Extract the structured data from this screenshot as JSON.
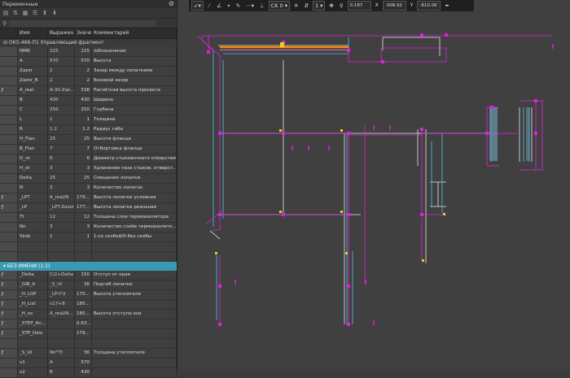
{
  "panel": {
    "title": "Переменные",
    "search_placeholder": "",
    "headers": [
      "",
      "Имя",
      "Выражен...",
      "Значе...",
      "Комментарий"
    ],
    "group1": "⊟  ОК5-466-П1 Управляющий фрагмент",
    "group2": "▾  БЕЗ ИМЕНИ (1:1)",
    "rows1": [
      {
        "icon": "",
        "name": "NMR",
        "expr": "225",
        "val": "225",
        "comment": "/обозначение"
      },
      {
        "icon": "",
        "name": "A",
        "expr": "570",
        "val": "570",
        "comment": "Высота"
      },
      {
        "icon": "",
        "name": "Zazor",
        "expr": "2",
        "val": "2",
        "comment": "Зазор между лопатками"
      },
      {
        "icon": "",
        "name": "Zazor_B",
        "expr": "2",
        "val": "2",
        "comment": "Боковой зазор"
      },
      {
        "icon": "ƒ",
        "name": "A_real",
        "expr": "A-30-Zaz...",
        "val": "538",
        "comment": "Расчётная высота просвета"
      },
      {
        "icon": "",
        "name": "B",
        "expr": "430",
        "val": "430",
        "comment": "Ширина"
      },
      {
        "icon": "",
        "name": "C",
        "expr": "250",
        "val": "250",
        "comment": "Глубина"
      },
      {
        "icon": "",
        "name": "L",
        "expr": "1",
        "val": "1",
        "comment": "Толщина"
      },
      {
        "icon": "",
        "name": "R",
        "expr": "1.2",
        "val": "1.2",
        "comment": "Радиус гиба"
      },
      {
        "icon": "",
        "name": "H_Flan",
        "expr": "25",
        "val": "25",
        "comment": "Высота фланца"
      },
      {
        "icon": "",
        "name": "B_Flan",
        "expr": "7",
        "val": "7",
        "comment": "Отбортовка фланца"
      },
      {
        "icon": "",
        "name": "D_ot",
        "expr": "6",
        "val": "6",
        "comment": "Диаметр стыковочного отверстия"
      },
      {
        "icon": "",
        "name": "H_ot",
        "expr": "3",
        "val": "3",
        "comment": "Удлинение паза стыков. отверст..."
      },
      {
        "icon": "",
        "name": "Delta",
        "expr": "25",
        "val": "25",
        "comment": "Смещение лопатки"
      },
      {
        "icon": "",
        "name": "N",
        "expr": "3",
        "val": "3",
        "comment": "Количество лопаток"
      },
      {
        "icon": "ƒ",
        "name": "_LPT",
        "expr": "A_real/N",
        "val": "179...",
        "comment": "Высота лопатки условная"
      },
      {
        "icon": "ƒ",
        "name": "_LP",
        "expr": "_LPT-Zazor",
        "val": "177...",
        "comment": "Высота лопатки реальная"
      },
      {
        "icon": "",
        "name": "Tt",
        "expr": "12",
        "val": "12",
        "comment": "Толщина слоя термоизолятора"
      },
      {
        "icon": "",
        "name": "Nn",
        "expr": "3",
        "val": "3",
        "comment": "Количество слоёв термоизолято..."
      },
      {
        "icon": "",
        "name": "Skob",
        "expr": "1",
        "val": "1",
        "comment": "1-со скобой/0-без скобы"
      }
    ],
    "rows2": [
      {
        "icon": "ƒ",
        "name": "_Delta",
        "expr": "C/2+Delta",
        "val": "150",
        "comment": "Отступ от края"
      },
      {
        "icon": "ƒ",
        "name": "_GIB_A",
        "expr": "_S_Ut",
        "val": "36",
        "comment": "Подгиб лопатки"
      },
      {
        "icon": "ƒ",
        "name": "_H_LOP",
        "expr": "_LP-t*2",
        "val": "175...",
        "comment": "Высота утеплителя"
      },
      {
        "icon": "ƒ",
        "name": "_H_List",
        "expr": "v17+8",
        "val": "185...",
        "comment": ""
      },
      {
        "icon": "ƒ",
        "name": "_H_os",
        "expr": "A_real/N...",
        "val": "185...",
        "comment": "Высота отступа оси"
      },
      {
        "icon": "ƒ",
        "name": "_STEP_An...",
        "expr": "",
        "val": "0.63...",
        "comment": ""
      },
      {
        "icon": "ƒ",
        "name": "_STP_Osio",
        "expr": "",
        "val": "179...",
        "comment": ""
      },
      {
        "icon": "",
        "name": "",
        "expr": "",
        "val": "",
        "comment": ""
      },
      {
        "icon": "ƒ",
        "name": "_S_Ut",
        "expr": "Nn*Tt",
        "val": "36",
        "comment": "Толщина утеплителя"
      },
      {
        "icon": "",
        "name": "v1",
        "expr": "A",
        "val": "570",
        "comment": ""
      },
      {
        "icon": "",
        "name": "v2",
        "expr": "B",
        "val": "430",
        "comment": ""
      }
    ]
  },
  "toolbar": {
    "ck": "CK 0",
    "layer": "1",
    "zoom": "0.187",
    "x_label": "X",
    "x_value": "-308.92",
    "y_label": "Y",
    "y_value": "-810.06"
  },
  "colors": {
    "cyan": "#4fc3d9",
    "magenta": "#e020e0",
    "white": "#e8e8e8",
    "yellow": "#e8d020",
    "orange": "#ff8a00",
    "selection": "#3b9ab3"
  }
}
